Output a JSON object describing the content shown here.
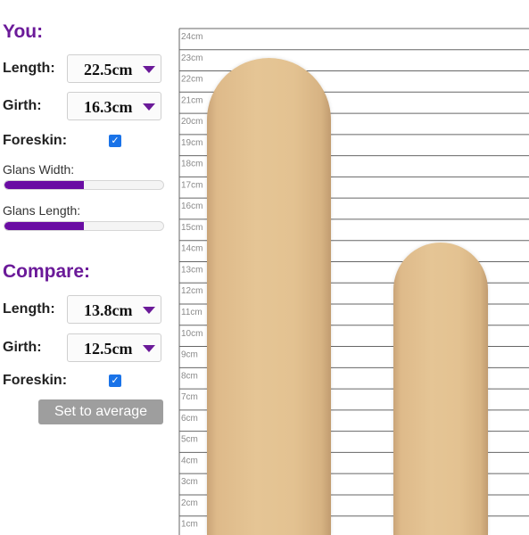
{
  "you": {
    "title": "You:",
    "length_label": "Length:",
    "length_value": "22.5cm",
    "girth_label": "Girth:",
    "girth_value": "16.3cm",
    "foreskin_label": "Foreskin:",
    "foreskin_checked": true,
    "glans_width_label": "Glans Width:",
    "glans_width_fraction": 0.5,
    "glans_length_label": "Glans Length:",
    "glans_length_fraction": 0.5
  },
  "compare": {
    "title": "Compare:",
    "length_label": "Length:",
    "length_value": "13.8cm",
    "girth_label": "Girth:",
    "girth_value": "12.5cm",
    "foreskin_label": "Foreskin:",
    "foreskin_checked": true,
    "average_button": "Set to average"
  },
  "scale": {
    "unit": "cm",
    "ticks": [
      "24cm",
      "23cm",
      "22cm",
      "21cm",
      "20cm",
      "19cm",
      "18cm",
      "17cm",
      "16cm",
      "15cm",
      "14cm",
      "13cm",
      "12cm",
      "11cm",
      "10cm",
      "9cm",
      "8cm",
      "7cm",
      "6cm",
      "5cm",
      "4cm",
      "3cm",
      "2cm",
      "1cm"
    ]
  },
  "colors": {
    "accent": "#6b1a99",
    "slider_fill": "#6a0da3",
    "checkbox": "#1a73e8",
    "button": "#9e9e9e",
    "skin": "#e3c291"
  }
}
